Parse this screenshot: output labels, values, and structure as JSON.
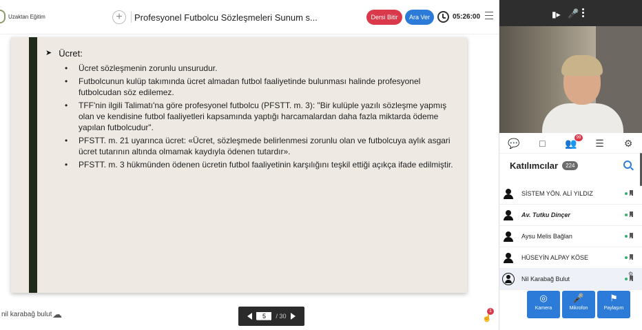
{
  "app": {
    "logo_label": "Uzaktan Eğitim"
  },
  "header": {
    "session_title": "Profesyonel Futbolcu Sözleşmeleri Sunum s...",
    "end_class_label": "Dersi Bitir",
    "break_label": "Ara Ver",
    "timer": "05:26:00",
    "colors": {
      "end": "#d9394b",
      "break": "#2d7bd8"
    }
  },
  "slide": {
    "heading": "Ücret:",
    "bullets": [
      "Ücret sözleşmenin zorunlu unsurudur.",
      "Futbolcunun kulüp takımında ücret almadan futbol faaliyetinde bulunması halinde profesyonel futbolcudan söz edilemez.",
      "TFF'nin ilgili Talimatı'na göre profesyonel futbolcu (PFSTT. m. 3): \"Bir kulüple yazılı sözleşme yapmış olan ve kendisine futbol faaliyetleri kapsamında yaptığı harcamalardan daha fazla miktarda ödeme yapılan futbolcudur\".",
      "PFSTT. m. 21 uyarınca ücret: «Ücret, sözleşmede belirlenmesi zorunlu olan ve futbolcuya aylık asgari ücret tutarının altında olmamak kaydıyla ödenen tutardır».",
      "PFSTT. m. 3 hükmünden ödenen ücretin futbol faaliyetinin karşılığını teşkil ettiği açıkça ifade edilmiştir."
    ]
  },
  "footer": {
    "username": "nil karabağ bulut",
    "page_current": "5",
    "page_total": "/ 30",
    "hand_badge": "1"
  },
  "panel": {
    "participants_title": "Katılımcılar",
    "participants_count": "224",
    "participants_badge": "99",
    "participants": [
      {
        "name": "SİSTEM YÖN. ALİ YILDIZ"
      },
      {
        "name": "Av. Tutku Dinçer"
      },
      {
        "name": "Aysu Melis Bağlan"
      },
      {
        "name": "HÜSEYİN ALPAY KÖSE"
      },
      {
        "name": "Nil Karabağ Bulut"
      }
    ],
    "actions": {
      "camera": "Kamera",
      "mic": "Mikrofon",
      "share": "Paylaşım"
    }
  },
  "icons": [
    "cam-off-icon",
    "mic-off-icon",
    "kebab-icon",
    "chat-icon",
    "whiteboard-icon",
    "participants-icon",
    "list-icon",
    "gear-icon",
    "search-icon",
    "clock-icon",
    "menu-icon",
    "cloud-icon",
    "hand-icon",
    "pin-icon"
  ]
}
